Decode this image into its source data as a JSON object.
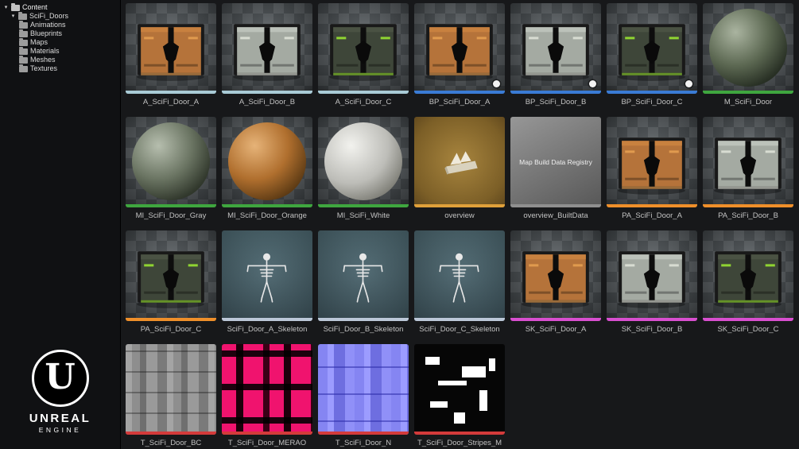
{
  "sidebar": {
    "root_label": "Content",
    "folder_label": "SciFi_Doors",
    "subfolders": [
      "Animations",
      "Blueprints",
      "Maps",
      "Materials",
      "Meshes",
      "Textures"
    ],
    "logo": {
      "monogram": "U",
      "line1": "UNREAL",
      "line2": "ENGINE"
    }
  },
  "colors": {
    "animation_bar": "#a9cbd6",
    "blueprint_bar": "#3a7bd5",
    "material_bar": "#3fa63f",
    "level_bar": "#dfa03a",
    "built_data_bar": "#8f8f8f",
    "physics_asset_bar": "#ef8f2a",
    "skeleton_bar": "#bcc8d8",
    "skeletal_mesh_bar": "#d94fd0",
    "texture_bar": "#d43b3b"
  },
  "grid": {
    "items": [
      {
        "name": "A_SciFi_Door_A",
        "thumb": "door-orange",
        "bar": "#a9cbd6"
      },
      {
        "name": "A_SciFi_Door_B",
        "thumb": "door-gray",
        "bar": "#a9cbd6"
      },
      {
        "name": "A_SciFi_Door_C",
        "thumb": "door-green",
        "bar": "#a9cbd6"
      },
      {
        "name": "BP_SciFi_Door_A",
        "thumb": "door-orange",
        "bar": "#3a7bd5",
        "badge": true
      },
      {
        "name": "BP_SciFi_Door_B",
        "thumb": "door-gray",
        "bar": "#3a7bd5",
        "badge": true
      },
      {
        "name": "BP_SciFi_Door_C",
        "thumb": "door-green",
        "bar": "#3a7bd5",
        "badge": true
      },
      {
        "name": "M_SciFi_Door",
        "thumb": "sphere-mat",
        "bar": "#3fa63f"
      },
      {
        "name": "MI_SciFi_Door_Gray",
        "thumb": "sphere-gray",
        "bar": "#3fa63f"
      },
      {
        "name": "MI_SciFi_Door_Orange",
        "thumb": "sphere-orange",
        "bar": "#3fa63f"
      },
      {
        "name": "MI_SciFi_White",
        "thumb": "sphere-white",
        "bar": "#3fa63f"
      },
      {
        "name": "overview",
        "thumb": "level",
        "bar": "#dfa03a"
      },
      {
        "name": "overview_BuiltData",
        "thumb": "builtdata",
        "bar": "#8f8f8f",
        "label": "Map Build Data Registry"
      },
      {
        "name": "PA_SciFi_Door_A",
        "thumb": "door-orange",
        "bar": "#ef8f2a"
      },
      {
        "name": "PA_SciFi_Door_B",
        "thumb": "door-gray",
        "bar": "#ef8f2a"
      },
      {
        "name": "PA_SciFi_Door_C",
        "thumb": "door-green",
        "bar": "#ef8f2a"
      },
      {
        "name": "SciFi_Door_A_Skeleton",
        "thumb": "skeleton",
        "bar": "#bcc8d8"
      },
      {
        "name": "SciFi_Door_B_Skeleton",
        "thumb": "skeleton",
        "bar": "#bcc8d8"
      },
      {
        "name": "SciFi_Door_C_Skeleton",
        "thumb": "skeleton",
        "bar": "#bcc8d8"
      },
      {
        "name": "SK_SciFi_Door_A",
        "thumb": "door-orange",
        "bar": "#d94fd0"
      },
      {
        "name": "SK_SciFi_Door_B",
        "thumb": "door-gray",
        "bar": "#d94fd0"
      },
      {
        "name": "SK_SciFi_Door_C",
        "thumb": "door-green",
        "bar": "#d94fd0"
      },
      {
        "name": "T_SciFi_Door_BC",
        "thumb": "tex-bc",
        "bar": "#d43b3b"
      },
      {
        "name": "T_SciFi_Door_MERAO",
        "thumb": "tex-merao",
        "bar": "#d43b3b"
      },
      {
        "name": "T_SciFi_Door_N",
        "thumb": "tex-n",
        "bar": "#d43b3b"
      },
      {
        "name": "T_SciFi_Door_Stripes_M",
        "thumb": "tex-stripes",
        "bar": "#d43b3b"
      }
    ]
  }
}
